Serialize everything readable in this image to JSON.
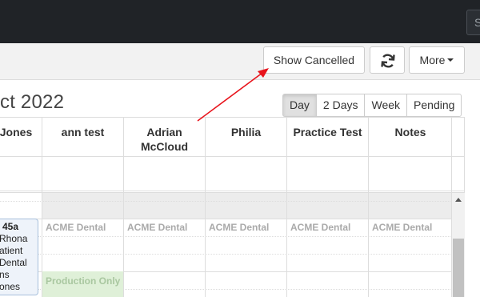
{
  "topbar": {
    "button_label": "S"
  },
  "toolbar": {
    "show_cancelled_label": "Show Cancelled",
    "more_label": "More"
  },
  "calendar": {
    "title": "ct 2022",
    "views": [
      "Day",
      "2 Days",
      "Week",
      "Pending"
    ],
    "active_view": "Day",
    "columns": [
      "Jones",
      "ann test",
      "Adrian McCloud",
      "Philia",
      "Practice Test",
      "Notes"
    ],
    "location_labels": [
      "ACME Dental",
      "ACME Dental",
      "ACME Dental",
      "ACME Dental",
      "ACME Dental"
    ],
    "production_label": "Production Only",
    "appointment": {
      "time": "45a",
      "lines": [
        "Rhona",
        "atient",
        "Dental",
        "ns",
        "ones"
      ]
    }
  },
  "colors": {
    "topbar": "#202327",
    "toolbar": "#f2f2f2",
    "production_block": "#dff0d8",
    "appointment_bg": "#eef3fa",
    "annotation_arrow": "#e8141c"
  },
  "icons": {
    "refresh": "refresh-icon",
    "more_caret": "caret-down-icon"
  }
}
